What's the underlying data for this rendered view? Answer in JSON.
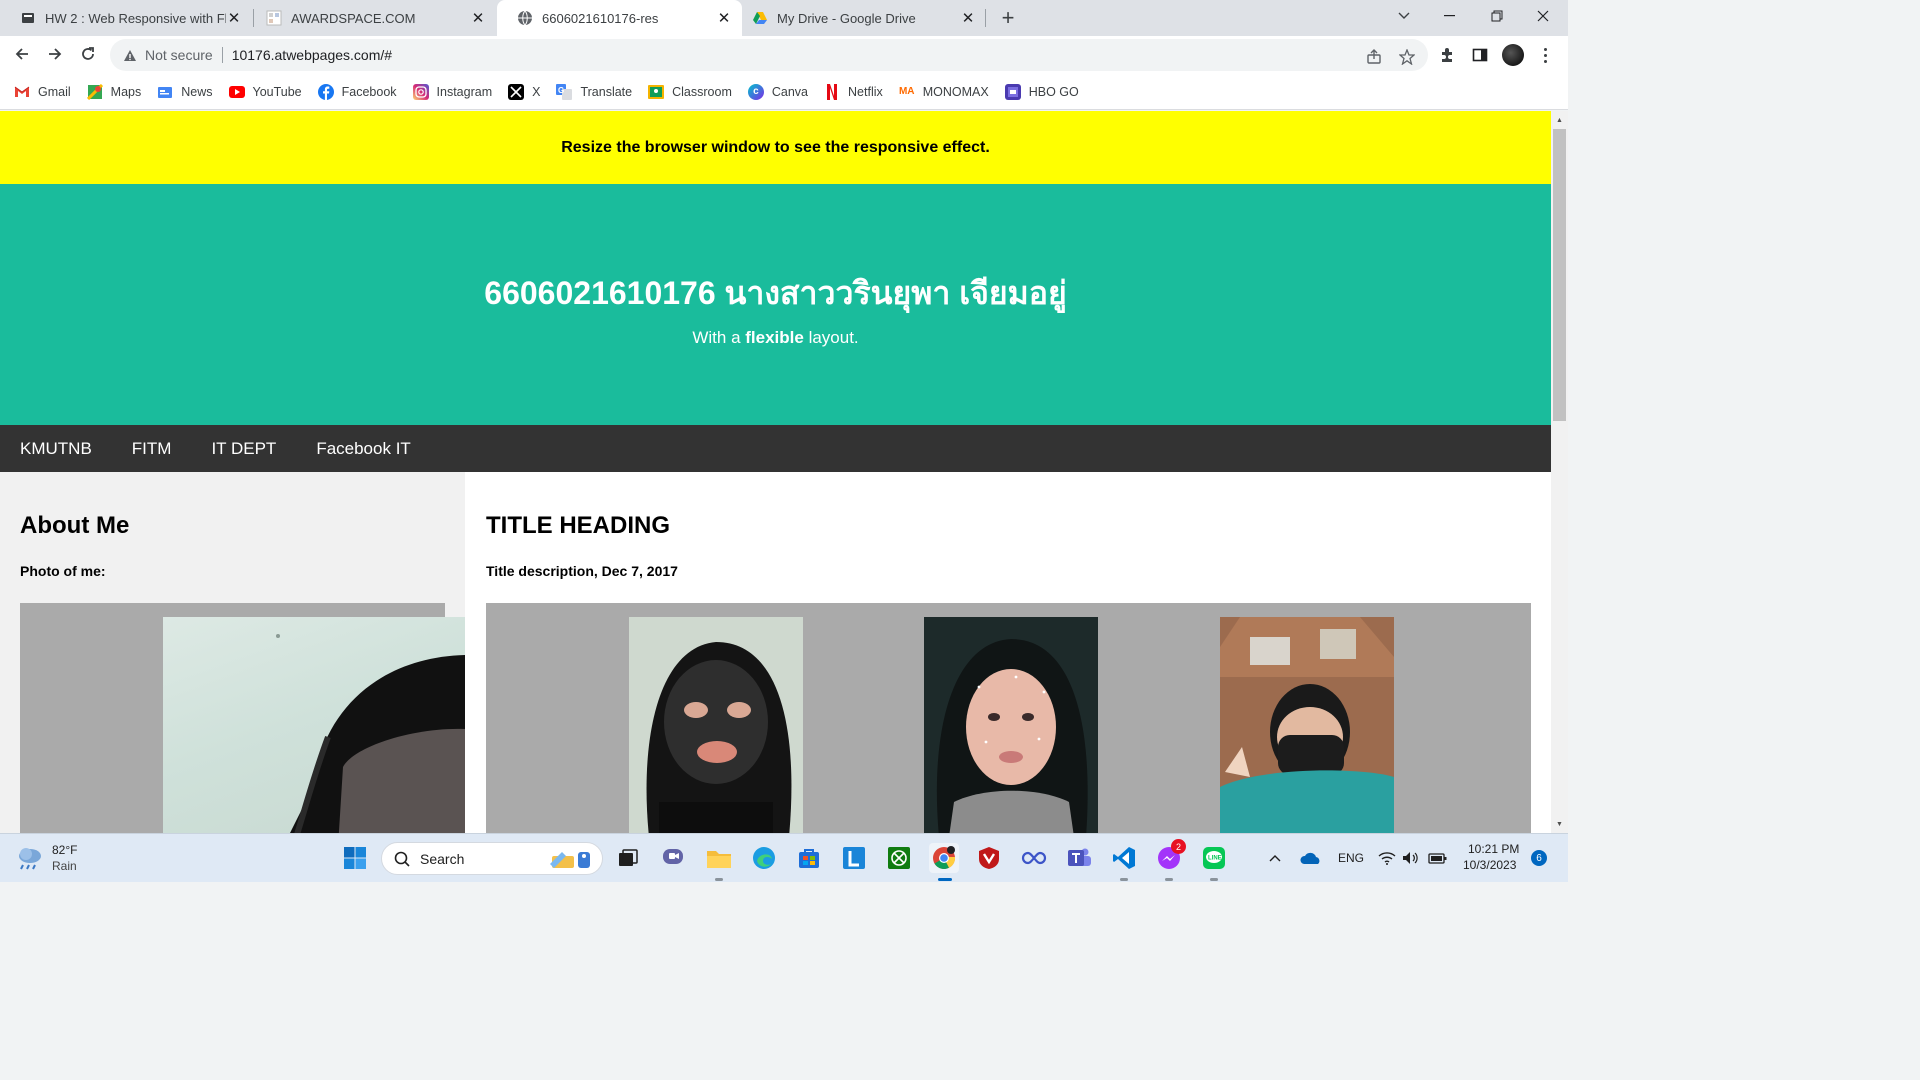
{
  "browser": {
    "tabs": [
      {
        "title": "HW 2 : Web Responsive with Fle",
        "icon": "page-icon",
        "active": false
      },
      {
        "title": "AWARDSPACE.COM",
        "icon": "awardspace-icon",
        "active": false
      },
      {
        "title": "6606021610176-res",
        "icon": "globe-icon",
        "active": true
      },
      {
        "title": "My Drive - Google Drive",
        "icon": "google-drive-icon",
        "active": false
      }
    ],
    "tab_close": "✕",
    "new_tab": "+",
    "omnibox": {
      "security": "Not secure",
      "url": "10176.atwebpages.com/#"
    },
    "bookmarks": [
      {
        "label": "Gmail",
        "icon": "gmail-icon",
        "color": "#ea4335"
      },
      {
        "label": "Maps",
        "icon": "maps-icon",
        "color": "#34a853"
      },
      {
        "label": "News",
        "icon": "news-icon",
        "color": "#4285f4"
      },
      {
        "label": "YouTube",
        "icon": "youtube-icon",
        "color": "#ff0000"
      },
      {
        "label": "Facebook",
        "icon": "facebook-icon",
        "color": "#1877f2"
      },
      {
        "label": "Instagram",
        "icon": "instagram-icon",
        "color": "#d6249f"
      },
      {
        "label": "X",
        "icon": "x-icon",
        "color": "#000000"
      },
      {
        "label": "Translate",
        "icon": "translate-icon",
        "color": "#4285f4"
      },
      {
        "label": "Classroom",
        "icon": "classroom-icon",
        "color": "#f4b400"
      },
      {
        "label": "Canva",
        "icon": "canva-icon",
        "color": "#00c4cc"
      },
      {
        "label": "Netflix",
        "icon": "netflix-icon",
        "color": "#e50914"
      },
      {
        "label": "MONOMAX",
        "icon": "monomax-icon",
        "color": "#ff6a00"
      },
      {
        "label": "HBO GO",
        "icon": "hbo-go-icon",
        "color": "#5c3bb8"
      }
    ]
  },
  "page": {
    "banner": "Resize the browser window to see the responsive effect.",
    "header": {
      "title": "6606021610176 นางสาววรินยุพา เจียมอยู่",
      "subtitle_pre": "With a ",
      "subtitle_bold": "flexible",
      "subtitle_post": " layout."
    },
    "nav": [
      "KMUTNB",
      "FITM",
      "IT DEPT",
      "Facebook IT"
    ],
    "side": {
      "heading": "About Me",
      "caption": "Photo of me:"
    },
    "main": {
      "heading": "TITLE HEADING",
      "caption": "Title description, Dec 7, 2017"
    }
  },
  "taskbar": {
    "weather": {
      "temp": "82°F",
      "condition": "Rain"
    },
    "search_label": "Search",
    "language": "ENG",
    "time": "10:21 PM",
    "date": "10/3/2023",
    "notifications": "6",
    "messenger_badge": "2"
  },
  "colors": {
    "banner": "#ffff00",
    "header": "#1abc9c",
    "navbar": "#333333"
  }
}
